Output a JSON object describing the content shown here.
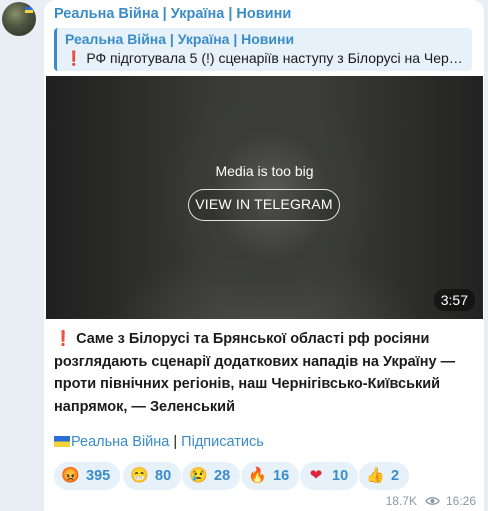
{
  "channel": {
    "name": "Реальна Війна | Україна | Новини"
  },
  "reply": {
    "title": "Реальна Війна | Україна | Новини",
    "mark": "❗",
    "text": "РФ підготувала 5 (!) сценаріїв наступу з Білорусі на Черні…"
  },
  "media": {
    "message": "Media is too big",
    "button": "VIEW IN TELEGRAM",
    "duration": "3:57"
  },
  "message": {
    "mark": "❗",
    "text": "Саме з Білорусі та Брянської області рф росіяни розглядають сценарії додаткових нападів на Україну — проти північних регіонів, наш Чернігівсько-Київський напрямок, — Зеленський"
  },
  "footer": {
    "channel_link": "Реальна Війна",
    "separator": " | ",
    "subscribe_link": "Підписатись"
  },
  "reactions": [
    {
      "icon": "angry-face-icon",
      "glyph": "😡",
      "count": "395"
    },
    {
      "icon": "grin-face-icon",
      "glyph": "😁",
      "count": "80"
    },
    {
      "icon": "crying-face-icon",
      "glyph": "😢",
      "count": "28"
    },
    {
      "icon": "fire-icon",
      "glyph": "🔥",
      "count": "16"
    },
    {
      "icon": "heart-icon",
      "glyph": "❤",
      "count": "10"
    },
    {
      "icon": "thumbs-up-icon",
      "glyph": "👍",
      "count": "2"
    }
  ],
  "meta": {
    "views": "18.7K",
    "time": "16:26"
  },
  "colors": {
    "accent": "#3a8cc8",
    "background": "#e8eef3",
    "reaction_bg": "#e7f1fa"
  }
}
